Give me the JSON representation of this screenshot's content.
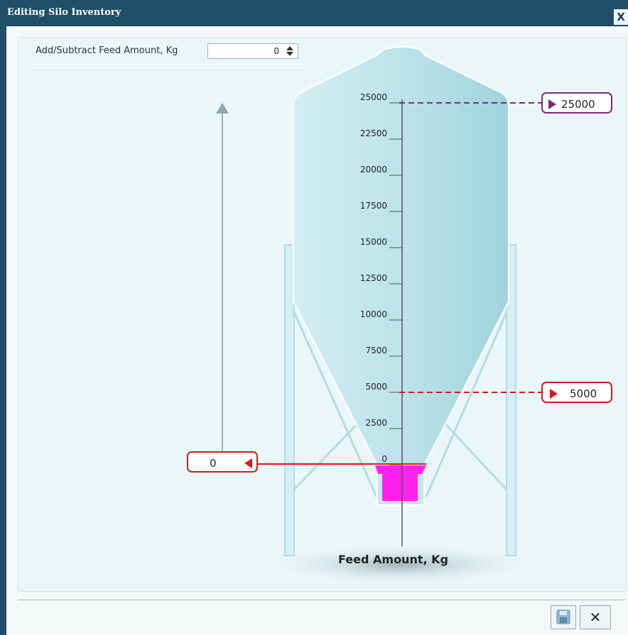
{
  "window": {
    "title": "Editing Silo Inventory",
    "close_label": "X"
  },
  "form": {
    "amount_label": "Add/Subtract Feed Amount, Kg",
    "amount_value": "0"
  },
  "gauge": {
    "ticks": [
      "25000",
      "22500",
      "20000",
      "17500",
      "15000",
      "12500",
      "10000",
      "7500",
      "5000",
      "2500",
      "0"
    ],
    "max_marker": "25000",
    "min_marker": "5000",
    "current_marker": "0",
    "axis_title": "Feed Amount, Kg",
    "max_color": "#7a2a7a",
    "alarm_color": "#e0141d",
    "fill_color": "#ff22ee"
  },
  "footer": {
    "save_icon": "save-icon",
    "cancel_icon": "close-icon",
    "cancel_label": "✕"
  }
}
